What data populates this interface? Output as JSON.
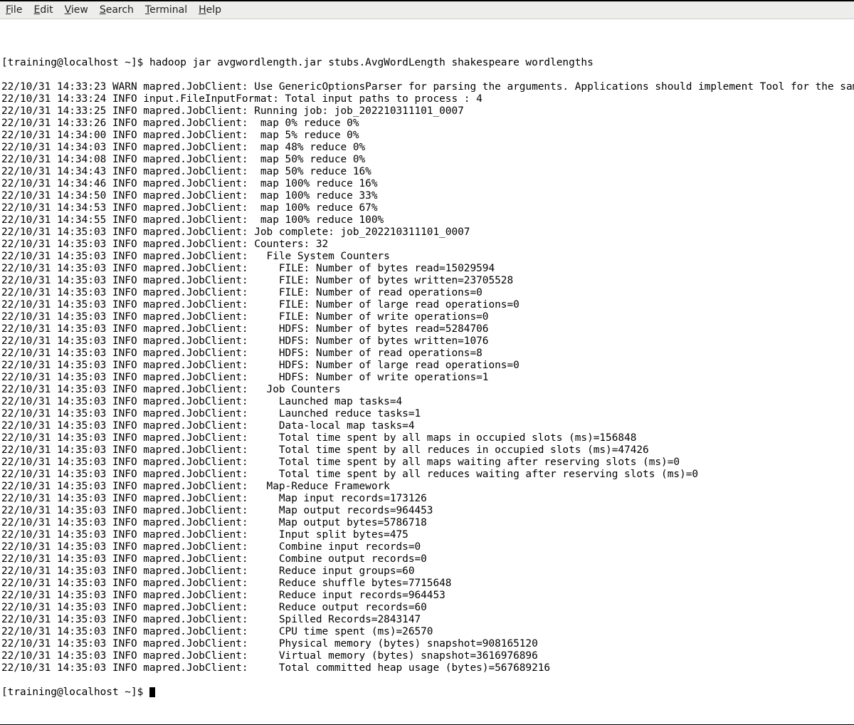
{
  "menubar": {
    "items": [
      {
        "mnemonic": "F",
        "rest": "ile"
      },
      {
        "mnemonic": "E",
        "rest": "dit"
      },
      {
        "mnemonic": "V",
        "rest": "iew"
      },
      {
        "mnemonic": "S",
        "rest": "earch"
      },
      {
        "mnemonic": "T",
        "rest": "erminal"
      },
      {
        "mnemonic": "H",
        "rest": "elp"
      }
    ]
  },
  "terminal": {
    "prompt1": "[training@localhost ~]$ ",
    "command": "hadoop jar avgwordlength.jar stubs.AvgWordLength shakespeare wordlengths",
    "lines": [
      "22/10/31 14:33:23 WARN mapred.JobClient: Use GenericOptionsParser for parsing the arguments. Applications should implement Tool for the same.",
      "22/10/31 14:33:24 INFO input.FileInputFormat: Total input paths to process : 4",
      "22/10/31 14:33:25 INFO mapred.JobClient: Running job: job_202210311101_0007",
      "22/10/31 14:33:26 INFO mapred.JobClient:  map 0% reduce 0%",
      "22/10/31 14:34:00 INFO mapred.JobClient:  map 5% reduce 0%",
      "22/10/31 14:34:03 INFO mapred.JobClient:  map 48% reduce 0%",
      "22/10/31 14:34:08 INFO mapred.JobClient:  map 50% reduce 0%",
      "22/10/31 14:34:43 INFO mapred.JobClient:  map 50% reduce 16%",
      "22/10/31 14:34:46 INFO mapred.JobClient:  map 100% reduce 16%",
      "22/10/31 14:34:50 INFO mapred.JobClient:  map 100% reduce 33%",
      "22/10/31 14:34:53 INFO mapred.JobClient:  map 100% reduce 67%",
      "22/10/31 14:34:55 INFO mapred.JobClient:  map 100% reduce 100%",
      "22/10/31 14:35:03 INFO mapred.JobClient: Job complete: job_202210311101_0007",
      "22/10/31 14:35:03 INFO mapred.JobClient: Counters: 32",
      "22/10/31 14:35:03 INFO mapred.JobClient:   File System Counters",
      "22/10/31 14:35:03 INFO mapred.JobClient:     FILE: Number of bytes read=15029594",
      "22/10/31 14:35:03 INFO mapred.JobClient:     FILE: Number of bytes written=23705528",
      "22/10/31 14:35:03 INFO mapred.JobClient:     FILE: Number of read operations=0",
      "22/10/31 14:35:03 INFO mapred.JobClient:     FILE: Number of large read operations=0",
      "22/10/31 14:35:03 INFO mapred.JobClient:     FILE: Number of write operations=0",
      "22/10/31 14:35:03 INFO mapred.JobClient:     HDFS: Number of bytes read=5284706",
      "22/10/31 14:35:03 INFO mapred.JobClient:     HDFS: Number of bytes written=1076",
      "22/10/31 14:35:03 INFO mapred.JobClient:     HDFS: Number of read operations=8",
      "22/10/31 14:35:03 INFO mapred.JobClient:     HDFS: Number of large read operations=0",
      "22/10/31 14:35:03 INFO mapred.JobClient:     HDFS: Number of write operations=1",
      "22/10/31 14:35:03 INFO mapred.JobClient:   Job Counters",
      "22/10/31 14:35:03 INFO mapred.JobClient:     Launched map tasks=4",
      "22/10/31 14:35:03 INFO mapred.JobClient:     Launched reduce tasks=1",
      "22/10/31 14:35:03 INFO mapred.JobClient:     Data-local map tasks=4",
      "22/10/31 14:35:03 INFO mapred.JobClient:     Total time spent by all maps in occupied slots (ms)=156848",
      "22/10/31 14:35:03 INFO mapred.JobClient:     Total time spent by all reduces in occupied slots (ms)=47426",
      "22/10/31 14:35:03 INFO mapred.JobClient:     Total time spent by all maps waiting after reserving slots (ms)=0",
      "22/10/31 14:35:03 INFO mapred.JobClient:     Total time spent by all reduces waiting after reserving slots (ms)=0",
      "22/10/31 14:35:03 INFO mapred.JobClient:   Map-Reduce Framework",
      "22/10/31 14:35:03 INFO mapred.JobClient:     Map input records=173126",
      "22/10/31 14:35:03 INFO mapred.JobClient:     Map output records=964453",
      "22/10/31 14:35:03 INFO mapred.JobClient:     Map output bytes=5786718",
      "22/10/31 14:35:03 INFO mapred.JobClient:     Input split bytes=475",
      "22/10/31 14:35:03 INFO mapred.JobClient:     Combine input records=0",
      "22/10/31 14:35:03 INFO mapred.JobClient:     Combine output records=0",
      "22/10/31 14:35:03 INFO mapred.JobClient:     Reduce input groups=60",
      "22/10/31 14:35:03 INFO mapred.JobClient:     Reduce shuffle bytes=7715648",
      "22/10/31 14:35:03 INFO mapred.JobClient:     Reduce input records=964453",
      "22/10/31 14:35:03 INFO mapred.JobClient:     Reduce output records=60",
      "22/10/31 14:35:03 INFO mapred.JobClient:     Spilled Records=2843147",
      "22/10/31 14:35:03 INFO mapred.JobClient:     CPU time spent (ms)=26570",
      "22/10/31 14:35:03 INFO mapred.JobClient:     Physical memory (bytes) snapshot=908165120",
      "22/10/31 14:35:03 INFO mapred.JobClient:     Virtual memory (bytes) snapshot=3616976896",
      "22/10/31 14:35:03 INFO mapred.JobClient:     Total committed heap usage (bytes)=567689216"
    ],
    "prompt2": "[training@localhost ~]$ "
  }
}
